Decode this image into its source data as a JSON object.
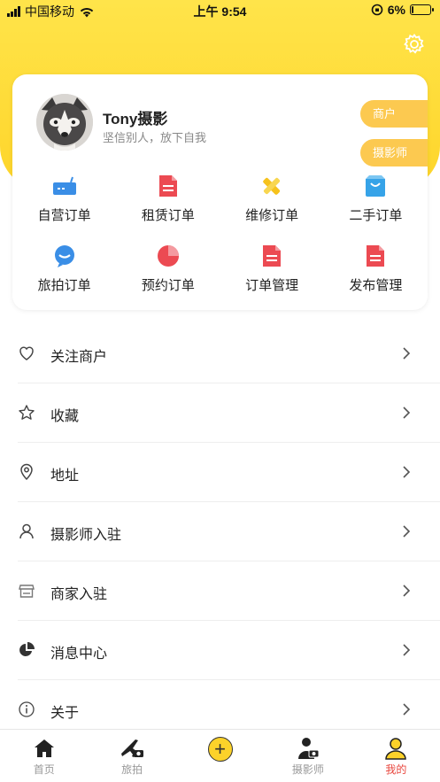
{
  "status_bar": {
    "carrier": "中国移动",
    "time": "上午 9:54",
    "battery_percent": "6%",
    "battery_level": 0.06
  },
  "profile": {
    "name": "Tony摄影",
    "motto": "坚信别人，放下自我",
    "role_merchant": "商户",
    "role_photographer": "摄影师"
  },
  "orders": [
    {
      "label": "自营订单",
      "icon": "router-icon"
    },
    {
      "label": "租赁订单",
      "icon": "document-icon"
    },
    {
      "label": "维修订单",
      "icon": "tools-icon"
    },
    {
      "label": "二手订单",
      "icon": "shopping-bag-icon"
    },
    {
      "label": "旅拍订单",
      "icon": "chat-bubble-icon"
    },
    {
      "label": "预约订单",
      "icon": "pie-chart-icon"
    },
    {
      "label": "订单管理",
      "icon": "document-icon"
    },
    {
      "label": "发布管理",
      "icon": "document-icon"
    }
  ],
  "menu": [
    {
      "label": "关注商户",
      "icon": "heart-icon"
    },
    {
      "label": "收藏",
      "icon": "star-icon"
    },
    {
      "label": "地址",
      "icon": "location-pin-icon"
    },
    {
      "label": "摄影师入驻",
      "icon": "user-icon"
    },
    {
      "label": "商家入驻",
      "icon": "store-icon"
    },
    {
      "label": "消息中心",
      "icon": "pie-chart-icon"
    },
    {
      "label": "关于",
      "icon": "info-icon"
    }
  ],
  "tabbar": [
    {
      "label": "首页",
      "icon": "home-icon"
    },
    {
      "label": "旅拍",
      "icon": "plane-camera-icon"
    },
    {
      "label": "",
      "icon": "plus-icon"
    },
    {
      "label": "摄影师",
      "icon": "photographer-icon"
    },
    {
      "label": "我的",
      "icon": "profile-icon",
      "active": true
    }
  ],
  "colors": {
    "brand_yellow": "#fed52a",
    "pill": "#fcc950",
    "accent_red": "#e8453c",
    "icon_blue": "#3a8ee6"
  }
}
